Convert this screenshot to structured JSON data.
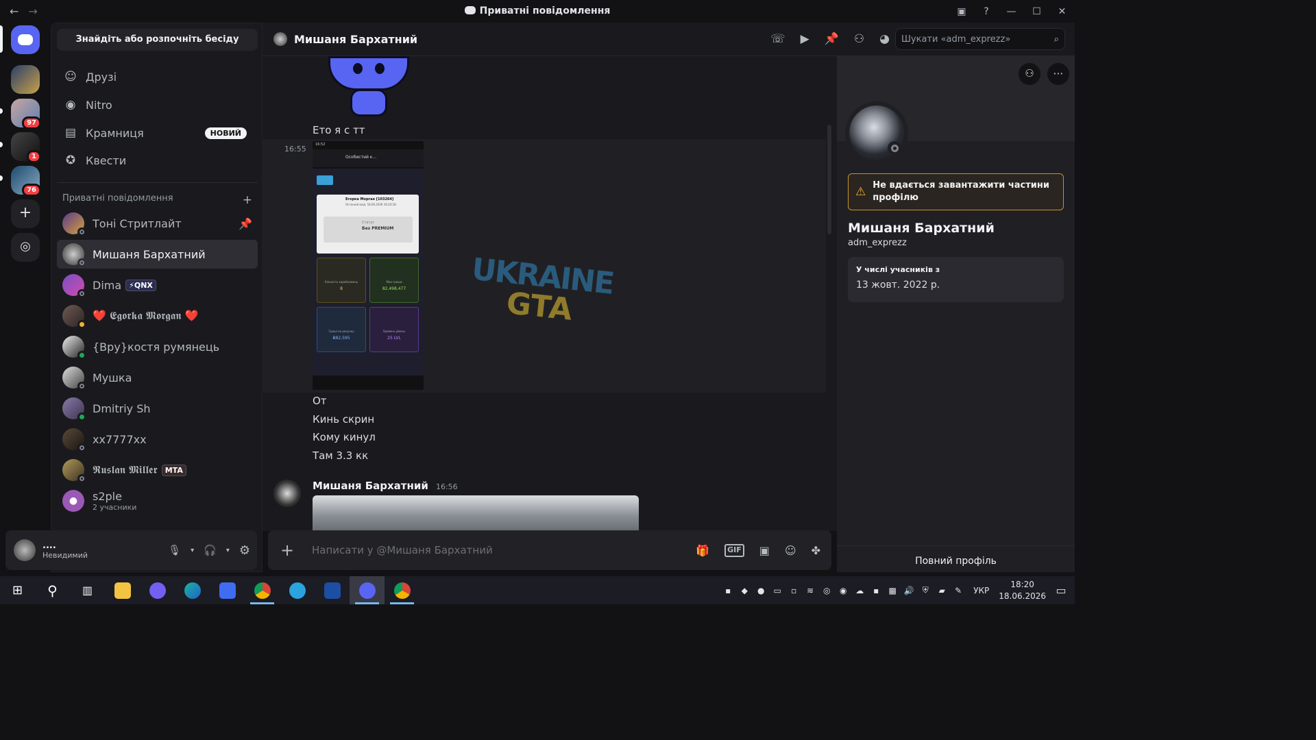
{
  "window": {
    "title": "Приватні повідомлення",
    "back_icon": "arrow-left-icon",
    "forward_icon": "arrow-right-icon"
  },
  "guilds": [
    {
      "name": "server-1",
      "color": "#3b4a6b"
    },
    {
      "name": "server-2",
      "badge": "97",
      "color": "#7b8aa3"
    },
    {
      "name": "server-3",
      "badge": "1",
      "color": "#3c3c44"
    },
    {
      "name": "server-4",
      "badge": "76",
      "color": "#2d4a60"
    }
  ],
  "dm_panel": {
    "search_label": "Знайдіть або розпочніть бесіду",
    "nav": [
      {
        "label": "Друзі",
        "icon": "friends-icon"
      },
      {
        "label": "Nitro",
        "icon": "nitro-icon"
      },
      {
        "label": "Крамниця",
        "icon": "shop-icon",
        "badge": "НОВИЙ"
      },
      {
        "label": "Квести",
        "icon": "quests-icon"
      }
    ],
    "section_title": "Приватні повідомлення",
    "conversations": [
      {
        "name": "Тоні Стритлайт",
        "pinned": true
      },
      {
        "name": "Мишаня Бархатний"
      },
      {
        "name": "Dima",
        "tag": "⚡QNX"
      },
      {
        "name": "❤️ 𝕰𝖌𝖔𝖗𝖐𝖆 𝕸𝖔𝖗𝖌𝖆𝖓 ❤️"
      },
      {
        "name": "{Вру}костя румянець"
      },
      {
        "name": "Мушка"
      },
      {
        "name": "Dmitriy Sh"
      },
      {
        "name": "xx7777xx"
      },
      {
        "name": "𝕽𝖚𝖘𝖑𝖆𝖓 𝕸𝖎𝖑𝖑𝖊𝖗",
        "tag": "MTA"
      },
      {
        "name": "s2ple",
        "sub": "2 учасники"
      }
    ]
  },
  "user_bar": {
    "name": "....",
    "status": "Невидимий"
  },
  "chat_header": {
    "name": "Мишаня Бархатний",
    "search_placeholder": "Шукати «adm_exprezz»"
  },
  "messages": {
    "line1": "Ето я с тт",
    "time1": "16:55",
    "lines": [
      "От",
      "Кинь скрин",
      "Кому кинул",
      "Там 3.3 кк"
    ],
    "author": "Мишаня Бархатний",
    "author_time": "16:56"
  },
  "screenshot_image": {
    "time": "16:52",
    "page_title": "Особистий к...",
    "user": "Егорка Морган [103264]",
    "last_login": "Останній вхід: 18.06.2026 16:24:18",
    "status_label": "Статус",
    "status_value": "Без PREMIUM",
    "tiles": [
      {
        "label": "Кількість коробкамень",
        "value": "8"
      },
      {
        "label": "Мои гроши",
        "value": "82,498,477"
      },
      {
        "label": "Гроші на рахунку",
        "value": "Ƀ82,595"
      },
      {
        "label": "Уровень рівень",
        "value": "25 LVL"
      }
    ]
  },
  "composer": {
    "placeholder": "Написати у @Мишаня Бархатний"
  },
  "profile": {
    "warning": "Не вдається завантажити частини профілю",
    "name": "Мишаня Бархатний",
    "username": "adm_exprezz",
    "member_since_label": "У числі учасників з",
    "member_since": "13 жовт. 2022 р.",
    "full_profile": "Повний профіль"
  },
  "taskbar": {
    "lang": "УКР",
    "time": "18:20",
    "date": "18.06.2026"
  }
}
